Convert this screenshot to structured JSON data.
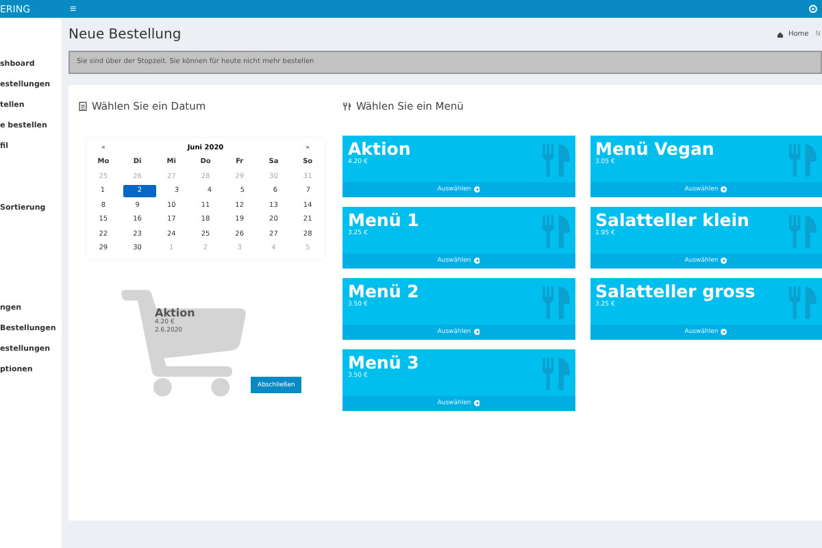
{
  "header": {
    "logo": "ERING",
    "menu_toggle": "≡"
  },
  "sidebar": {
    "groups": [
      [
        "shboard",
        "estellungen",
        "tellen",
        "e bestellen",
        "fil"
      ],
      [
        "Sortierung"
      ],
      [
        "ngen",
        "Bestellungen",
        "estellungen",
        "ptionen"
      ]
    ]
  },
  "page": {
    "title": "Neue Bestellung",
    "breadcrumb": [
      "Home",
      "N"
    ]
  },
  "alert": "Sie sind über der Stopzeit. Sie können für heute nicht mehr bestellen",
  "date_panel": {
    "title": "Wählen Sie ein Datum",
    "calendar": {
      "prev": "«",
      "month": "Juni 2020",
      "next": "»",
      "weekdays": [
        "Mo",
        "Di",
        "Mi",
        "Do",
        "Fr",
        "Sa",
        "So"
      ],
      "weeks": [
        [
          {
            "day": "25",
            "muted": true,
            "selected": false
          },
          {
            "day": "26",
            "muted": true,
            "selected": false
          },
          {
            "day": "27",
            "muted": true,
            "selected": false
          },
          {
            "day": "28",
            "muted": true,
            "selected": false
          },
          {
            "day": "29",
            "muted": true,
            "selected": false
          },
          {
            "day": "30",
            "muted": true,
            "selected": false
          },
          {
            "day": "31",
            "muted": true,
            "selected": false
          }
        ],
        [
          {
            "day": "1",
            "muted": false,
            "selected": false
          },
          {
            "day": "2",
            "muted": false,
            "selected": true
          },
          {
            "day": "3",
            "muted": false,
            "selected": false
          },
          {
            "day": "4",
            "muted": false,
            "selected": false
          },
          {
            "day": "5",
            "muted": false,
            "selected": false
          },
          {
            "day": "6",
            "muted": false,
            "selected": false
          },
          {
            "day": "7",
            "muted": false,
            "selected": false
          }
        ],
        [
          {
            "day": "8",
            "muted": false,
            "selected": false
          },
          {
            "day": "9",
            "muted": false,
            "selected": false
          },
          {
            "day": "10",
            "muted": false,
            "selected": false
          },
          {
            "day": "11",
            "muted": false,
            "selected": false
          },
          {
            "day": "12",
            "muted": false,
            "selected": false
          },
          {
            "day": "13",
            "muted": false,
            "selected": false
          },
          {
            "day": "14",
            "muted": false,
            "selected": false
          }
        ],
        [
          {
            "day": "15",
            "muted": false,
            "selected": false
          },
          {
            "day": "16",
            "muted": false,
            "selected": false
          },
          {
            "day": "17",
            "muted": false,
            "selected": false
          },
          {
            "day": "18",
            "muted": false,
            "selected": false
          },
          {
            "day": "19",
            "muted": false,
            "selected": false
          },
          {
            "day": "20",
            "muted": false,
            "selected": false
          },
          {
            "day": "21",
            "muted": false,
            "selected": false
          }
        ],
        [
          {
            "day": "22",
            "muted": false,
            "selected": false
          },
          {
            "day": "23",
            "muted": false,
            "selected": false
          },
          {
            "day": "24",
            "muted": false,
            "selected": false
          },
          {
            "day": "25",
            "muted": false,
            "selected": false
          },
          {
            "day": "26",
            "muted": false,
            "selected": false
          },
          {
            "day": "27",
            "muted": false,
            "selected": false
          },
          {
            "day": "28",
            "muted": false,
            "selected": false
          }
        ],
        [
          {
            "day": "29",
            "muted": false,
            "selected": false
          },
          {
            "day": "30",
            "muted": false,
            "selected": false
          },
          {
            "day": "1",
            "muted": true,
            "selected": false
          },
          {
            "day": "2",
            "muted": true,
            "selected": false
          },
          {
            "day": "3",
            "muted": true,
            "selected": false
          },
          {
            "day": "4",
            "muted": true,
            "selected": false
          },
          {
            "day": "5",
            "muted": true,
            "selected": false
          }
        ]
      ]
    },
    "cart": {
      "name": "Aktion",
      "price": "4.20 €",
      "date": "2.6.2020",
      "button": "Abschließen"
    }
  },
  "menu_panel": {
    "title": "Wählen Sie ein Menü",
    "columns": [
      [
        {
          "name": "Aktion",
          "price": "4.20 €",
          "action": "Auswählen"
        },
        {
          "name": "Menü 1",
          "price": "3.25 €",
          "action": "Auswählen"
        },
        {
          "name": "Menü 2",
          "price": "3.50 €",
          "action": "Auswählen"
        },
        {
          "name": "Menü 3",
          "price": "3.50 €",
          "action": "Auswählen"
        }
      ],
      [
        {
          "name": "Menü Vegan",
          "price": "3.05 €",
          "action": "Auswählen"
        },
        {
          "name": "Salatteller klein",
          "price": "1.95 €",
          "action": "Auswählen"
        },
        {
          "name": "Salatteller gross",
          "price": "3.25 €",
          "action": "Auswählen"
        }
      ]
    ]
  }
}
